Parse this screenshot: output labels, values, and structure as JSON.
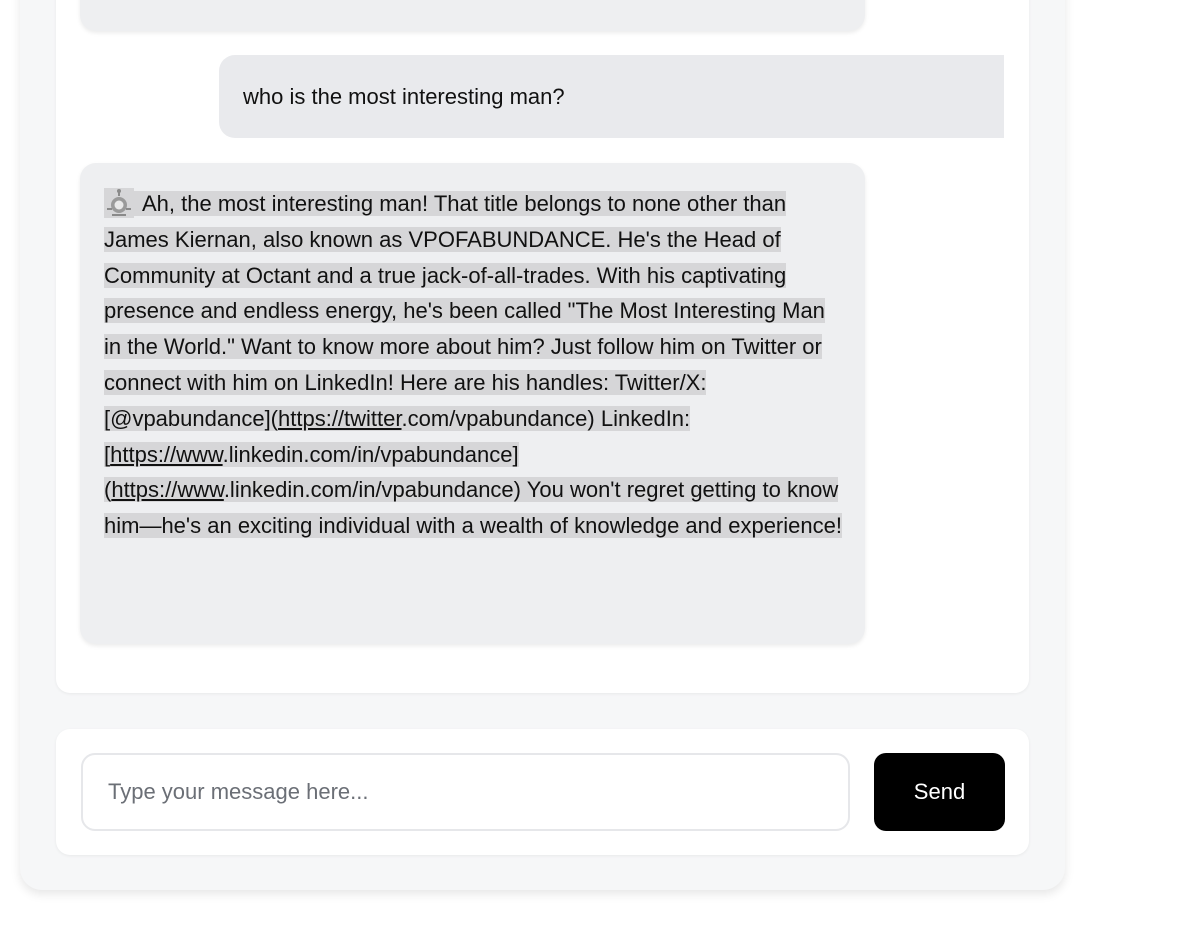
{
  "messages": {
    "user": {
      "text": "who is the most interesting man?"
    },
    "bot": {
      "avatar_icon": "robot-avatar-icon",
      "text_before_links": "Ah, the most interesting man! That title belongs to none other than James Kiernan, also known as VPOFABUNDANCE. He's the Head of Community at Octant and a true jack-of-all-trades. With his captivating presence and endless energy, he's been called \"The Most Interesting Man in the World.\" Want to know more about him? Just follow him on Twitter or connect with him on LinkedIn! Here are his handles: Twitter/X: [@vpabundance](",
      "link_twitter": "https://twitter",
      "text_after_twitter": ".com/vpabundance) LinkedIn: [",
      "link_linkedin_1": "https://www",
      "text_after_linkedin_1": ".linkedin.com/in/vpabundance] (",
      "link_linkedin_2": "https://www",
      "text_after_linkedin_2": ".linkedin.com/in/vpabundance) You won't regret getting to know him—he's an exciting individual with a wealth of knowledge and experience!"
    }
  },
  "composer": {
    "placeholder": "Type your message here...",
    "send_label": "Send"
  },
  "colors": {
    "send_button": "#000000",
    "bubble_bg": "#eeeff1",
    "selection_highlight": "#d6d6d8"
  }
}
